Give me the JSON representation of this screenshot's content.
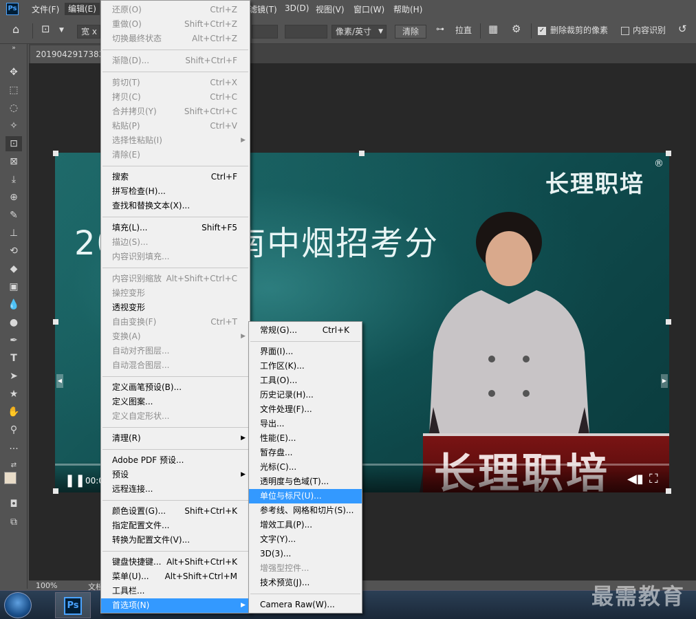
{
  "app": {
    "logo": "Ps"
  },
  "menubar": {
    "items": [
      "文件(F)",
      "编辑(E)",
      "滤镜(T)",
      "3D(D)",
      "视图(V)",
      "窗口(W)",
      "帮助(H)"
    ]
  },
  "options": {
    "width_label": "宽 x",
    "unit": "像素/英寸",
    "clear": "清除",
    "straighten": "拉直",
    "delete_cropped": "删除裁剪的像素",
    "content_aware": "内容识别"
  },
  "document": {
    "tab_title": "20190429173838",
    "zoom": "100%",
    "status": "文档"
  },
  "photo": {
    "brand": "长理职培",
    "registered": "®",
    "headline": "2019年湖南中烟招考分",
    "podium_text": "长理职培",
    "time_label": "00:0"
  },
  "edit_menu": {
    "items": [
      {
        "label": "还原(O)",
        "shortcut": "Ctrl+Z",
        "disabled": true
      },
      {
        "label": "重做(O)",
        "shortcut": "Shift+Ctrl+Z",
        "disabled": true
      },
      {
        "label": "切换最终状态",
        "shortcut": "Alt+Ctrl+Z",
        "disabled": true
      },
      {
        "label": "渐隐(D)...",
        "shortcut": "Shift+Ctrl+F",
        "disabled": true
      },
      {
        "label": "剪切(T)",
        "shortcut": "Ctrl+X",
        "disabled": true
      },
      {
        "label": "拷贝(C)",
        "shortcut": "Ctrl+C",
        "disabled": true
      },
      {
        "label": "合并拷贝(Y)",
        "shortcut": "Shift+Ctrl+C",
        "disabled": true
      },
      {
        "label": "粘贴(P)",
        "shortcut": "Ctrl+V",
        "disabled": true
      },
      {
        "label": "选择性粘贴(I)",
        "shortcut": "",
        "disabled": true
      },
      {
        "label": "清除(E)",
        "shortcut": "",
        "disabled": true
      },
      {
        "label": "搜索",
        "shortcut": "Ctrl+F",
        "disabled": false
      },
      {
        "label": "拼写检查(H)...",
        "shortcut": "",
        "disabled": false
      },
      {
        "label": "查找和替换文本(X)...",
        "shortcut": "",
        "disabled": false
      },
      {
        "label": "填充(L)...",
        "shortcut": "Shift+F5",
        "disabled": false
      },
      {
        "label": "描边(S)...",
        "shortcut": "",
        "disabled": true
      },
      {
        "label": "内容识别填充...",
        "shortcut": "",
        "disabled": true
      },
      {
        "label": "内容识别缩放",
        "shortcut": "Alt+Shift+Ctrl+C",
        "disabled": true
      },
      {
        "label": "操控变形",
        "shortcut": "",
        "disabled": true
      },
      {
        "label": "透视变形",
        "shortcut": "",
        "disabled": false
      },
      {
        "label": "自由变换(F)",
        "shortcut": "Ctrl+T",
        "disabled": true
      },
      {
        "label": "变换(A)",
        "shortcut": "",
        "disabled": true
      },
      {
        "label": "自动对齐图层...",
        "shortcut": "",
        "disabled": true
      },
      {
        "label": "自动混合图层...",
        "shortcut": "",
        "disabled": true
      },
      {
        "label": "定义画笔预设(B)...",
        "shortcut": "",
        "disabled": false
      },
      {
        "label": "定义图案...",
        "shortcut": "",
        "disabled": false
      },
      {
        "label": "定义自定形状...",
        "shortcut": "",
        "disabled": true
      },
      {
        "label": "清理(R)",
        "shortcut": "",
        "disabled": false
      },
      {
        "label": "Adobe PDF 预设...",
        "shortcut": "",
        "disabled": false
      },
      {
        "label": "预设",
        "shortcut": "",
        "disabled": false
      },
      {
        "label": "远程连接...",
        "shortcut": "",
        "disabled": false
      },
      {
        "label": "颜色设置(G)...",
        "shortcut": "Shift+Ctrl+K",
        "disabled": false
      },
      {
        "label": "指定配置文件...",
        "shortcut": "",
        "disabled": false
      },
      {
        "label": "转换为配置文件(V)...",
        "shortcut": "",
        "disabled": false
      },
      {
        "label": "键盘快捷键...",
        "shortcut": "Alt+Shift+Ctrl+K",
        "disabled": false
      },
      {
        "label": "菜单(U)...",
        "shortcut": "Alt+Shift+Ctrl+M",
        "disabled": false
      },
      {
        "label": "工具栏...",
        "shortcut": "",
        "disabled": false
      },
      {
        "label": "首选项(N)",
        "shortcut": "",
        "disabled": false
      }
    ]
  },
  "pref_menu": {
    "items": [
      {
        "label": "常规(G)...",
        "shortcut": "Ctrl+K",
        "disabled": false
      },
      {
        "label": "界面(I)...",
        "shortcut": "",
        "disabled": false
      },
      {
        "label": "工作区(K)...",
        "shortcut": "",
        "disabled": false
      },
      {
        "label": "工具(O)...",
        "shortcut": "",
        "disabled": false
      },
      {
        "label": "历史记录(H)...",
        "shortcut": "",
        "disabled": false
      },
      {
        "label": "文件处理(F)...",
        "shortcut": "",
        "disabled": false
      },
      {
        "label": "导出...",
        "shortcut": "",
        "disabled": false
      },
      {
        "label": "性能(E)...",
        "shortcut": "",
        "disabled": false
      },
      {
        "label": "暂存盘...",
        "shortcut": "",
        "disabled": false
      },
      {
        "label": "光标(C)...",
        "shortcut": "",
        "disabled": false
      },
      {
        "label": "透明度与色域(T)...",
        "shortcut": "",
        "disabled": false
      },
      {
        "label": "单位与标尺(U)...",
        "shortcut": "",
        "disabled": false
      },
      {
        "label": "参考线、网格和切片(S)...",
        "shortcut": "",
        "disabled": false
      },
      {
        "label": "增效工具(P)...",
        "shortcut": "",
        "disabled": false
      },
      {
        "label": "文字(Y)...",
        "shortcut": "",
        "disabled": false
      },
      {
        "label": "3D(3)...",
        "shortcut": "",
        "disabled": false
      },
      {
        "label": "增强型控件...",
        "shortcut": "",
        "disabled": true
      },
      {
        "label": "技术预览(J)...",
        "shortcut": "",
        "disabled": false
      },
      {
        "label": "Camera Raw(W)...",
        "shortcut": "",
        "disabled": false
      }
    ]
  },
  "watermark": "最需教育",
  "colors": {
    "highlight": "#3399ff",
    "ps_blue": "#4aa3ff"
  }
}
